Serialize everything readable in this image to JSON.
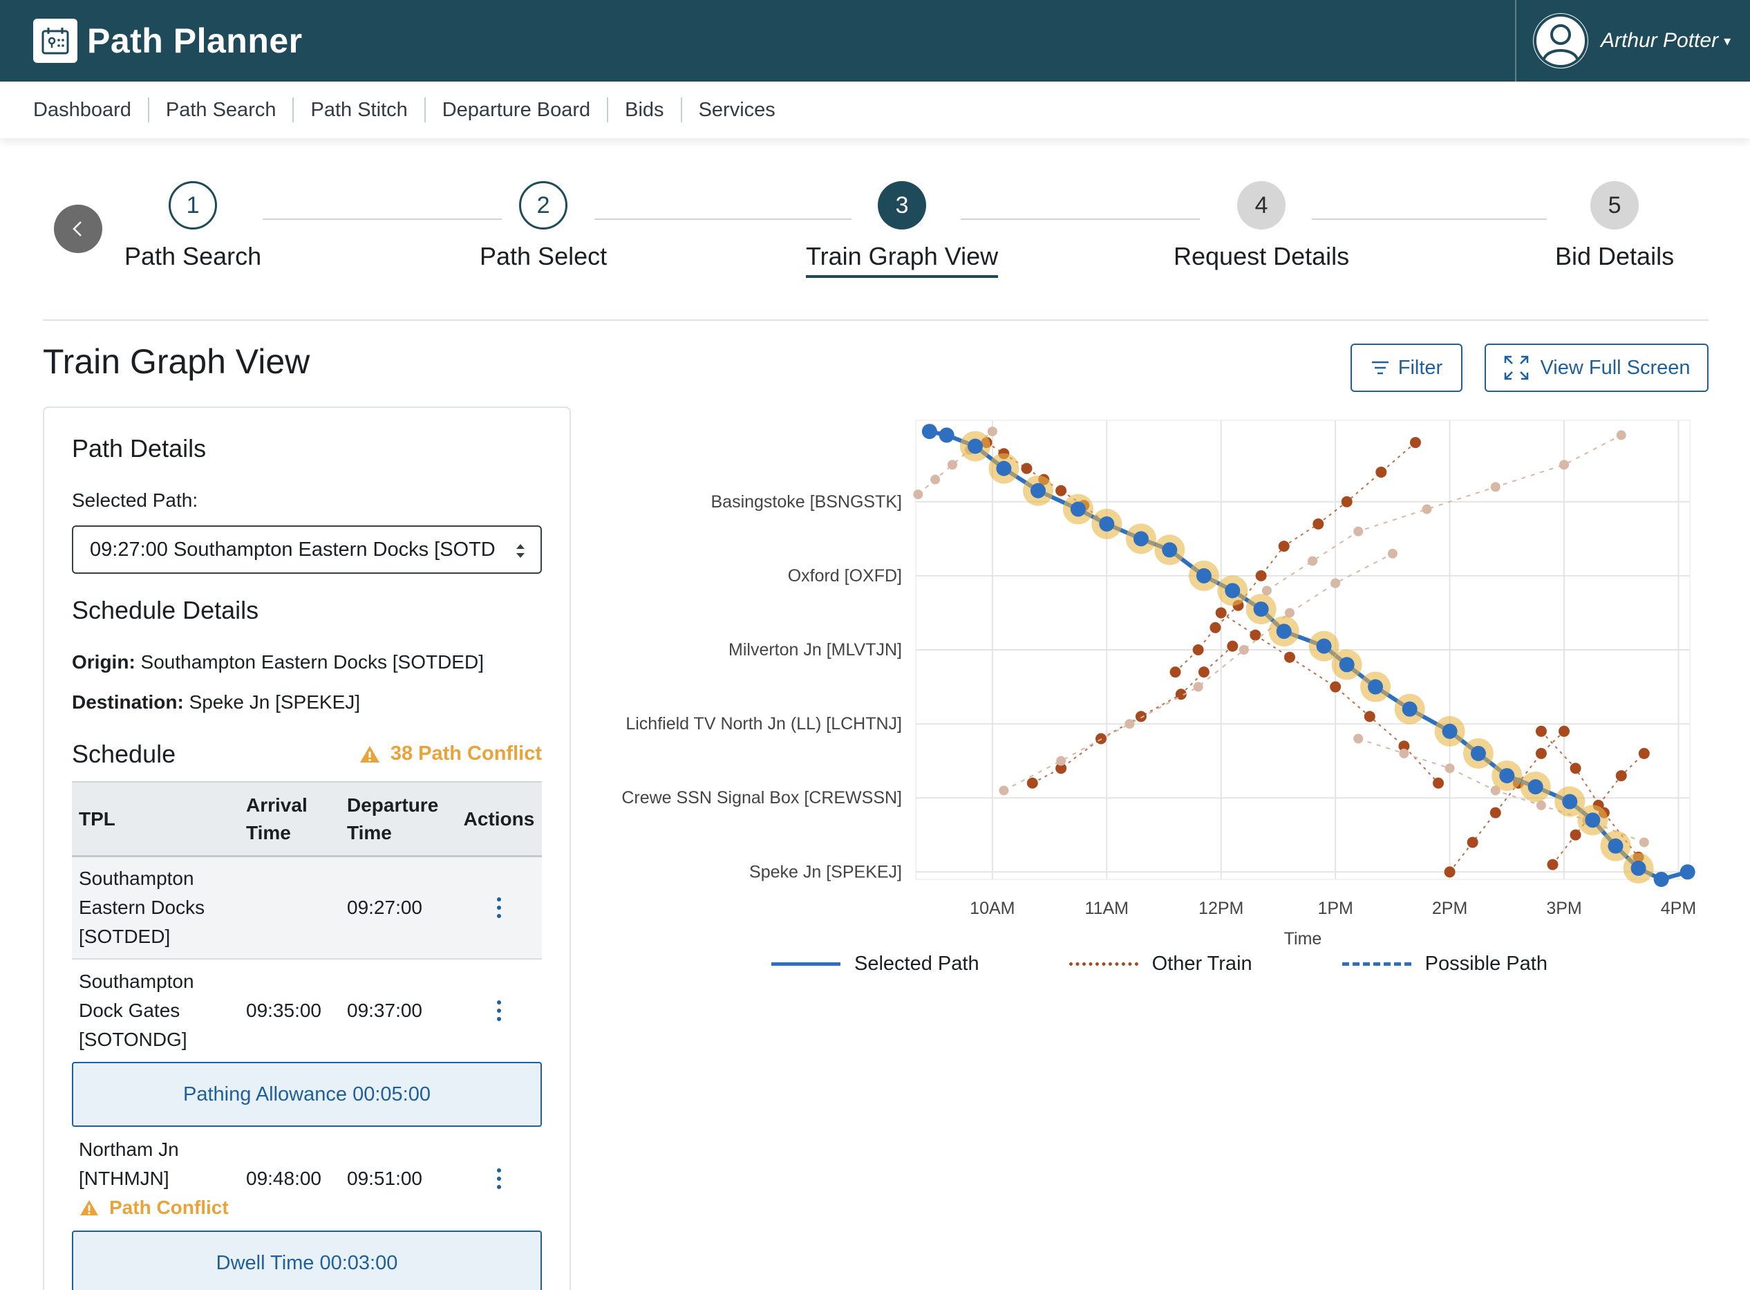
{
  "app": {
    "title": "Path Planner"
  },
  "user": {
    "name": "Arthur Potter"
  },
  "nav": [
    "Dashboard",
    "Path Search",
    "Path Stitch",
    "Departure Board",
    "Bids",
    "Services"
  ],
  "stepper": {
    "steps": [
      {
        "number": "1",
        "label": "Path Search",
        "state": "done"
      },
      {
        "number": "2",
        "label": "Path Select",
        "state": "done"
      },
      {
        "number": "3",
        "label": "Train Graph View",
        "state": "active"
      },
      {
        "number": "4",
        "label": "Request Details",
        "state": "pending"
      },
      {
        "number": "5",
        "label": "Bid Details",
        "state": "pending"
      }
    ]
  },
  "page": {
    "title": "Train Graph View",
    "filter_label": "Filter",
    "fullscreen_label": "View Full Screen"
  },
  "path_details": {
    "title": "Path Details",
    "selected_path_label": "Selected Path:",
    "selected_path_value": "09:27:00 Southampton Eastern Docks [SOTD",
    "schedule_details_title": "Schedule Details",
    "origin_label": "Origin:",
    "origin_value": "Southampton Eastern Docks [SOTDED]",
    "destination_label": "Destination:",
    "destination_value": "Speke Jn [SPEKEJ]",
    "schedule_title": "Schedule",
    "conflict_summary": "38 Path Conflict"
  },
  "schedule_table": {
    "headers": [
      "TPL",
      "Arrival Time",
      "Departure Time",
      "Actions"
    ],
    "rows": [
      {
        "tpl": "Southampton Eastern Docks [SOTDED]",
        "arrival": "",
        "departure": "09:27:00",
        "conflict": ""
      },
      {
        "tpl": "Southampton Dock Gates [SOTONDG]",
        "arrival": "09:35:00",
        "departure": "09:37:00",
        "conflict": ""
      },
      {
        "tpl": "Northam Jn [NTHMJN]",
        "arrival": "09:48:00",
        "departure": "09:51:00",
        "conflict": "Path Conflict"
      }
    ],
    "allowances": [
      "Pathing Allowance 00:05:00",
      "Dwell Time 00:03:00"
    ]
  },
  "chart_data": {
    "type": "line",
    "xlabel": "Time",
    "ylabel": "",
    "x_ticks": [
      "10AM",
      "11AM",
      "12PM",
      "1PM",
      "2PM",
      "3PM",
      "4PM"
    ],
    "xlim_hours": [
      9.33,
      16.1
    ],
    "y_categories": [
      "Basingstoke [BSNGSTK]",
      "Oxford [OXFD]",
      "Milverton Jn [MLVTJN]",
      "Lichfield TV North Jn (LL) [LCHTNJ]",
      "Crewe SSN Signal Box [CREWSSN]",
      "Speke Jn [SPEKEJ]"
    ],
    "ylim_index": [
      -1.1,
      5.1
    ],
    "grid": true,
    "legend": [
      "Selected Path",
      "Other Train",
      "Possible Path"
    ],
    "legend_position": "bottom",
    "colors": {
      "selected": "#2f6fbf",
      "other": "#a84a1e",
      "possible": "#d7b7a5",
      "conflict": "#e8b54a"
    },
    "series": [
      {
        "name": "Selected Path",
        "x": [
          9.45,
          9.6,
          9.85,
          10.1,
          10.4,
          10.75,
          11.0,
          11.3,
          11.55,
          11.85,
          12.1,
          12.35,
          12.55,
          12.9,
          13.1,
          13.35,
          13.65,
          14.0,
          14.25,
          14.5,
          14.75,
          15.05,
          15.25,
          15.45,
          15.65,
          15.85,
          16.08
        ],
        "y": [
          -0.95,
          -0.9,
          -0.75,
          -0.45,
          -0.15,
          0.1,
          0.3,
          0.5,
          0.65,
          1.0,
          1.2,
          1.45,
          1.75,
          1.95,
          2.2,
          2.5,
          2.8,
          3.1,
          3.4,
          3.7,
          3.85,
          4.05,
          4.3,
          4.65,
          4.95,
          5.1,
          5.0
        ]
      },
      {
        "name": "Other Train",
        "x": [
          9.95,
          10.1,
          10.3,
          10.45,
          10.6,
          10.8,
          11.0
        ],
        "y": [
          -0.8,
          -0.65,
          -0.45,
          -0.3,
          -0.15,
          0.05,
          0.3
        ]
      },
      {
        "name": "Other Train",
        "x": [
          11.6,
          11.8,
          11.95,
          12.15,
          12.35,
          12.55,
          12.85,
          13.1,
          13.4,
          13.7
        ],
        "y": [
          2.3,
          2.0,
          1.7,
          1.4,
          1.0,
          0.6,
          0.3,
          0.0,
          -0.4,
          -0.8
        ]
      },
      {
        "name": "Other Train",
        "x": [
          10.35,
          10.6,
          10.95,
          11.3,
          11.65,
          11.85,
          12.1
        ],
        "y": [
          3.8,
          3.6,
          3.2,
          2.9,
          2.6,
          2.3,
          1.95
        ]
      },
      {
        "name": "Other Train",
        "x": [
          12.0,
          12.3,
          12.6,
          13.0,
          13.3,
          13.6,
          13.9
        ],
        "y": [
          1.5,
          1.8,
          2.1,
          2.5,
          2.9,
          3.3,
          3.8
        ]
      },
      {
        "name": "Other Train",
        "x": [
          14.0,
          14.2,
          14.4,
          14.6,
          14.8,
          15.0
        ],
        "y": [
          5.0,
          4.6,
          4.2,
          3.8,
          3.4,
          3.1
        ]
      },
      {
        "name": "Other Train",
        "x": [
          14.9,
          15.1,
          15.3,
          15.5,
          15.7
        ],
        "y": [
          4.9,
          4.5,
          4.1,
          3.7,
          3.4
        ]
      },
      {
        "name": "Other Train",
        "x": [
          14.8,
          15.1,
          15.35,
          15.65
        ],
        "y": [
          3.1,
          3.6,
          4.2,
          4.8
        ]
      },
      {
        "name": "Possible Path",
        "x": [
          9.35,
          9.5,
          9.65,
          9.8,
          10.0
        ],
        "y": [
          -0.1,
          -0.3,
          -0.5,
          -0.7,
          -0.95
        ]
      },
      {
        "name": "Possible Path",
        "x": [
          10.1,
          10.6,
          11.2,
          11.8,
          12.2,
          12.6,
          13.0,
          13.5
        ],
        "y": [
          3.9,
          3.5,
          3.0,
          2.5,
          2.0,
          1.5,
          1.1,
          0.7
        ]
      },
      {
        "name": "Possible Path",
        "x": [
          12.4,
          12.8,
          13.2,
          13.8,
          14.4,
          15.0,
          15.5
        ],
        "y": [
          1.2,
          0.8,
          0.4,
          0.1,
          -0.2,
          -0.5,
          -0.9
        ]
      },
      {
        "name": "Possible Path",
        "x": [
          13.2,
          13.6,
          14.0,
          14.4,
          14.8,
          15.2,
          15.7
        ],
        "y": [
          3.2,
          3.4,
          3.6,
          3.9,
          4.1,
          4.3,
          4.6
        ]
      }
    ]
  }
}
